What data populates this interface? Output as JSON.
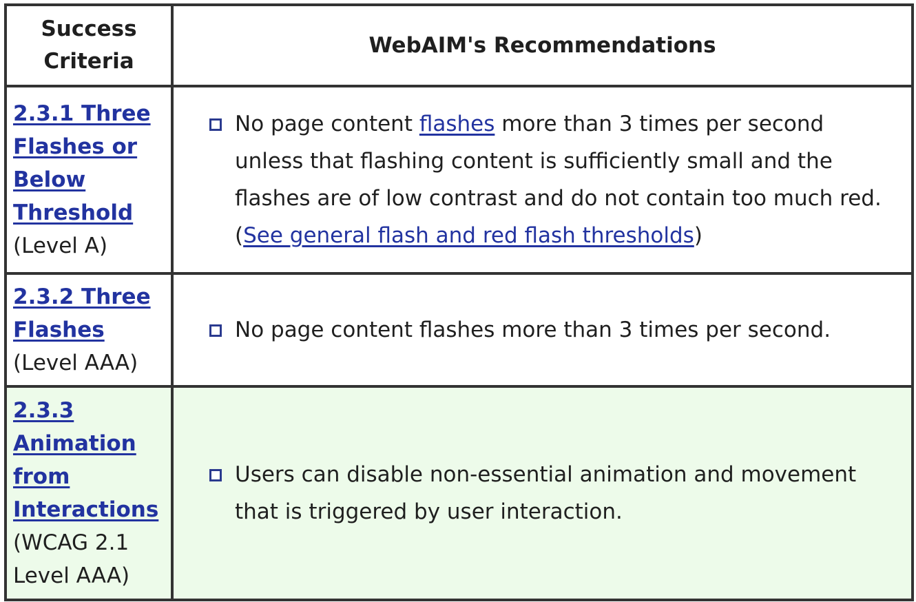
{
  "table": {
    "headers": {
      "success_criteria": "Success Criteria",
      "recommendations": "WebAIM's Recommendations"
    },
    "rows": [
      {
        "criterion_link": "2.3.1 Three Flashes or Below Threshold",
        "level": "(Level A)",
        "rec_text_1": "No page content ",
        "rec_link_1": "flashes",
        "rec_text_2": " more than 3 times per second unless that flashing content is sufficiently small and the flashes are of low contrast and do not contain too much red. (",
        "rec_link_2": "See general flash and red flash thresholds",
        "rec_text_3": ")"
      },
      {
        "criterion_link": "2.3.2 Three Flashes",
        "level": "(Level AAA)",
        "rec_text": "No page content flashes more than 3 times per second."
      },
      {
        "criterion_link": "2.3.3 Animation from Interactions",
        "level": "(WCAG 2.1 Level AAA)",
        "rec_text": "Users can disable non-essential animation and movement that is triggered by user interaction.",
        "highlight_color": "#edfbea"
      }
    ],
    "link_color": "#2233a0",
    "border_color": "#333333",
    "bullet_icon": "square-bullet-icon"
  }
}
